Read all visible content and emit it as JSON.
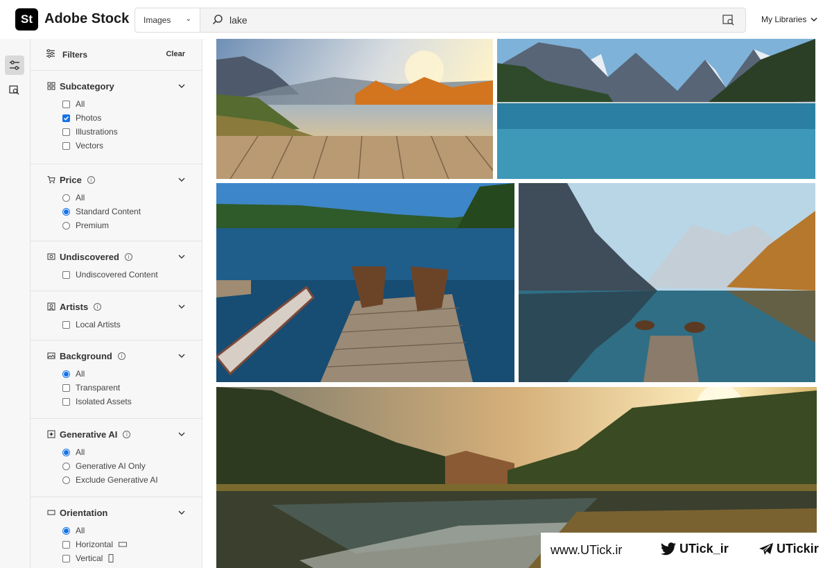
{
  "header": {
    "logo_text": "St",
    "brand": "Adobe Stock",
    "asset_type": "Images",
    "search_value": "lake",
    "my_libraries": "My Libraries"
  },
  "filters": {
    "title": "Filters",
    "clear": "Clear",
    "sections": [
      {
        "title": "Subcategory",
        "options": [
          {
            "label": "All",
            "kind": "checkbox",
            "checked": false
          },
          {
            "label": "Photos",
            "kind": "checkbox",
            "checked": true
          },
          {
            "label": "Illustrations",
            "kind": "checkbox",
            "checked": false
          },
          {
            "label": "Vectors",
            "kind": "checkbox",
            "checked": false
          }
        ]
      },
      {
        "title": "Price",
        "options": [
          {
            "label": "All",
            "kind": "radio",
            "checked": false
          },
          {
            "label": "Standard Content",
            "kind": "radio",
            "checked": true
          },
          {
            "label": "Premium",
            "kind": "radio",
            "checked": false
          }
        ]
      },
      {
        "title": "Undiscovered",
        "options": [
          {
            "label": "Undiscovered Content",
            "kind": "checkbox",
            "checked": false
          }
        ]
      },
      {
        "title": "Artists",
        "options": [
          {
            "label": "Local Artists",
            "kind": "checkbox",
            "checked": false
          }
        ]
      },
      {
        "title": "Background",
        "options": [
          {
            "label": "All",
            "kind": "radio",
            "checked": true
          },
          {
            "label": "Transparent",
            "kind": "checkbox",
            "checked": false
          },
          {
            "label": "Isolated Assets",
            "kind": "checkbox",
            "checked": false
          }
        ]
      },
      {
        "title": "Generative AI",
        "options": [
          {
            "label": "All",
            "kind": "radio",
            "checked": true
          },
          {
            "label": "Generative AI Only",
            "kind": "radio",
            "checked": false
          },
          {
            "label": "Exclude Generative AI",
            "kind": "radio",
            "checked": false
          }
        ]
      },
      {
        "title": "Orientation",
        "options": [
          {
            "label": "All",
            "kind": "radio",
            "checked": true
          },
          {
            "label": "Horizontal",
            "kind": "checkbox",
            "checked": false
          },
          {
            "label": "Vertical",
            "kind": "checkbox",
            "checked": false
          }
        ]
      }
    ]
  },
  "watermark": {
    "site": "www.UTick.ir",
    "twitter": "UTick_ir",
    "telegram": "UTickir"
  },
  "colors": {
    "accent": "#1473e6"
  }
}
